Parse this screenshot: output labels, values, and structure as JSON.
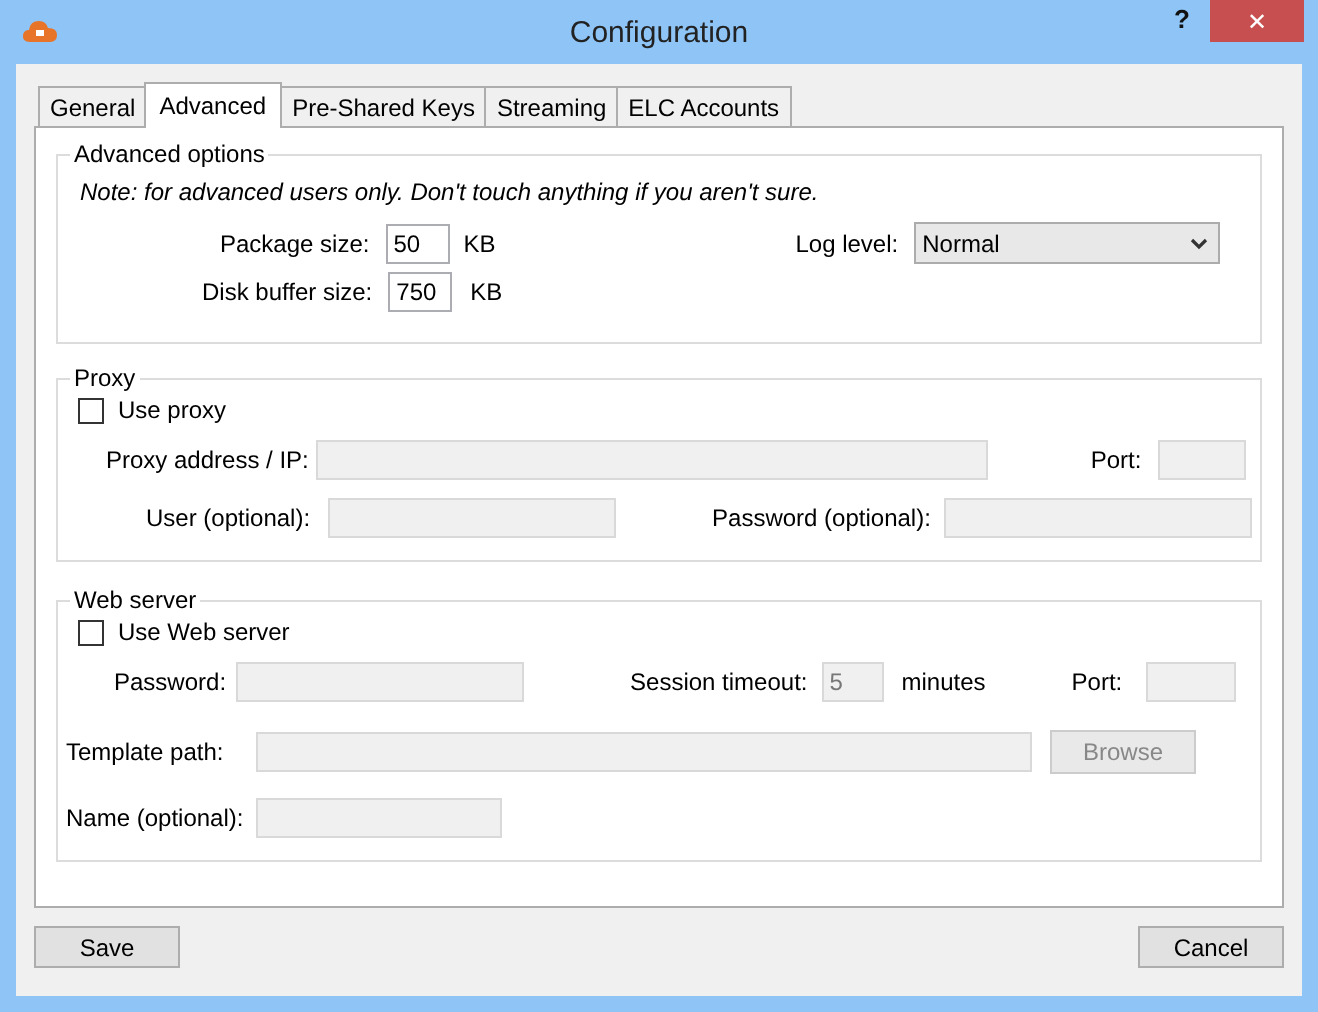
{
  "window": {
    "title": "Configuration",
    "help": "?",
    "close": "✕"
  },
  "tabs": [
    {
      "label": "General",
      "selected": false
    },
    {
      "label": "Advanced",
      "selected": true
    },
    {
      "label": "Pre-Shared Keys",
      "selected": false
    },
    {
      "label": "Streaming",
      "selected": false
    },
    {
      "label": "ELC Accounts",
      "selected": false
    }
  ],
  "advanced": {
    "title": "Advanced options",
    "note": "Note: for advanced users only. Don't touch anything if you aren't sure.",
    "package_size": {
      "label": "Package size:",
      "value": "50",
      "unit": "KB"
    },
    "disk_buffer": {
      "label": "Disk buffer size:",
      "value": "750",
      "unit": "KB"
    },
    "log_level": {
      "label": "Log level:",
      "value": "Normal"
    }
  },
  "proxy": {
    "title": "Proxy",
    "use": {
      "label": "Use proxy",
      "checked": false
    },
    "address": {
      "label": "Proxy address / IP:",
      "disabled": true
    },
    "port": {
      "label": "Port:",
      "disabled": true
    },
    "user": {
      "label": "User (optional):",
      "disabled": true
    },
    "password": {
      "label": "Password (optional):",
      "disabled": true
    }
  },
  "web_server": {
    "title": "Web server",
    "use": {
      "label": "Use Web server",
      "checked": false
    },
    "password": {
      "label": "Password:",
      "disabled": true
    },
    "session_timeout": {
      "label": "Session timeout:",
      "value": "5",
      "unit": "minutes",
      "disabled": true
    },
    "port": {
      "label": "Port:",
      "disabled": true
    },
    "template_path": {
      "label": "Template path:",
      "disabled": true
    },
    "browse": {
      "label": "Browse",
      "disabled": true
    },
    "name": {
      "label": "Name (optional):",
      "disabled": true
    }
  },
  "buttons": [
    {
      "label": "Save"
    },
    {
      "label": "Cancel"
    }
  ]
}
